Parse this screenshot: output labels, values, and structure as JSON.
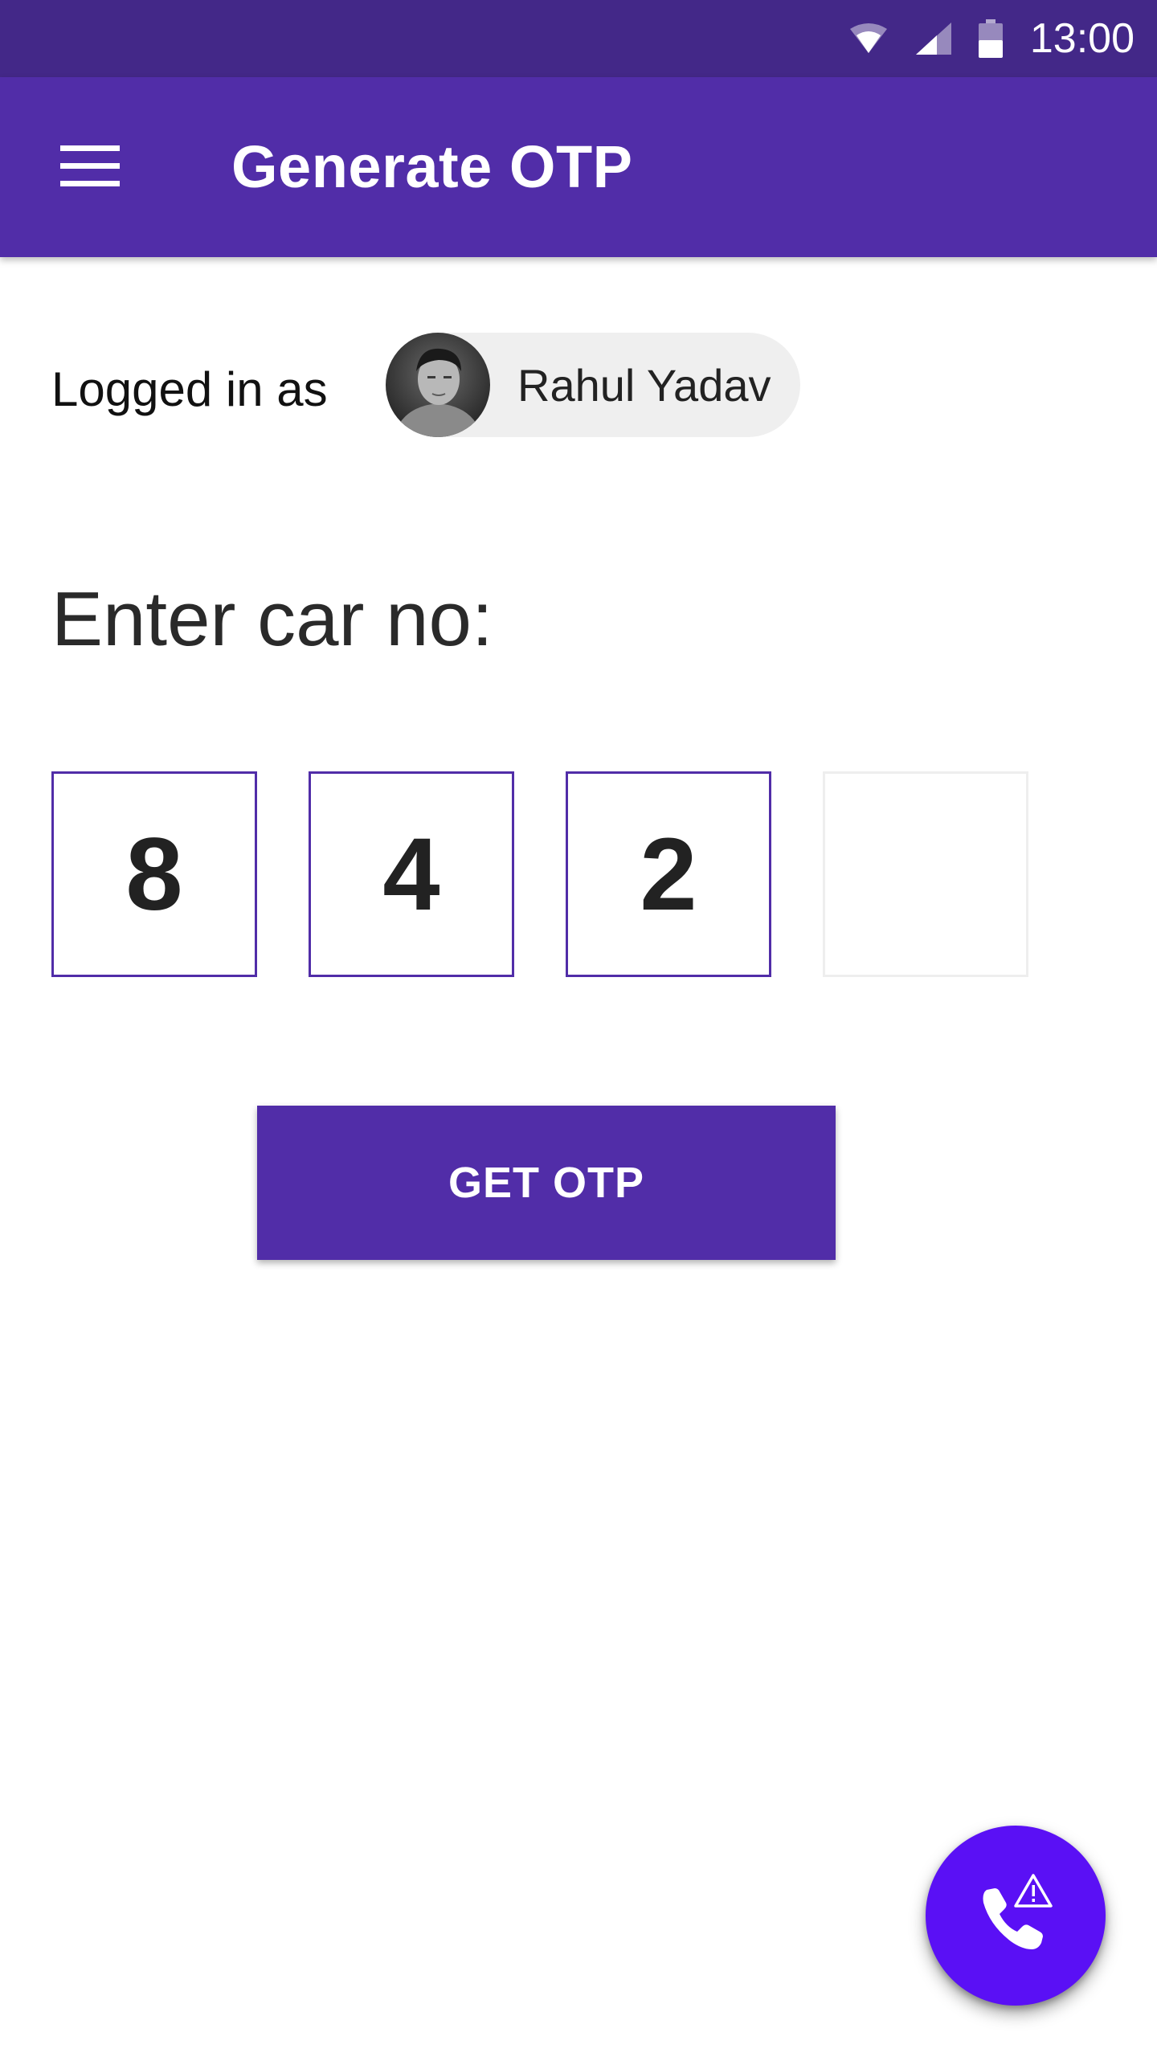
{
  "status_bar": {
    "time": "13:00",
    "icons": [
      "wifi-icon",
      "signal-icon",
      "battery-icon"
    ]
  },
  "app_bar": {
    "title": "Generate OTP",
    "menu_icon": "hamburger-menu-icon"
  },
  "user": {
    "label": "Logged in as",
    "name": "Rahul Yadav"
  },
  "car_entry": {
    "label": "Enter car no:",
    "digits": [
      "8",
      "4",
      "2",
      ""
    ]
  },
  "actions": {
    "get_otp_label": "GET OTP",
    "fab_icon": "phone-alert-icon"
  },
  "colors": {
    "status_bar": "#432888",
    "primary": "#512da8",
    "fab": "#5a10f5",
    "chip_bg": "#efefef"
  }
}
